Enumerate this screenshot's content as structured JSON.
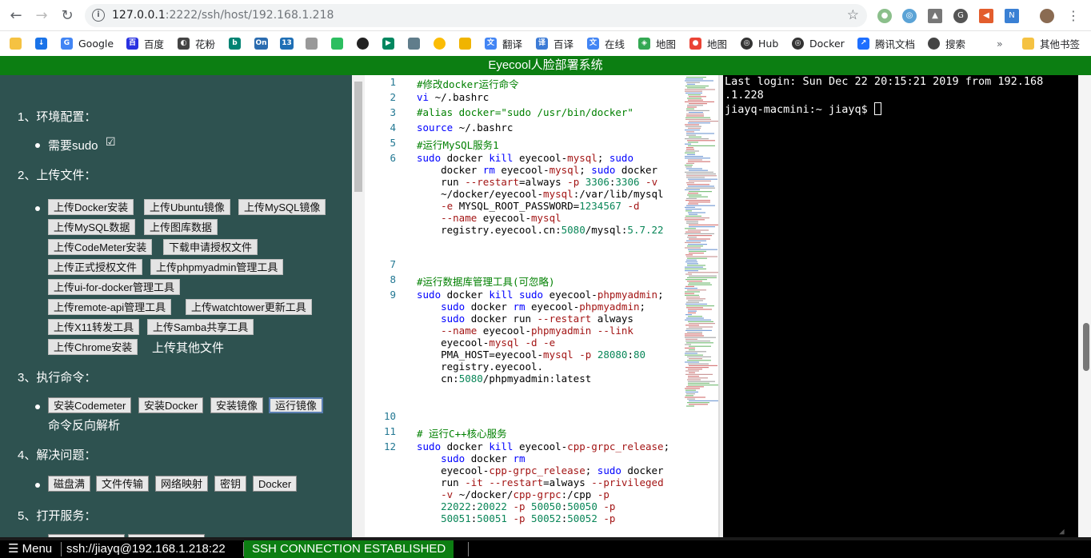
{
  "browser": {
    "url_host": "127.0.0.1",
    "url_rest": ":2222/ssh/host/192.168.1.218",
    "bookmarks": [
      "Google",
      "百度",
      "花粉",
      "",
      "On",
      "13",
      "",
      "",
      "",
      "",
      "",
      "",
      "",
      "",
      "翻译",
      "百译",
      "在线",
      "地图",
      "地图",
      "Hub",
      "Docker",
      "腾讯文档",
      "搜索",
      "其他书签"
    ]
  },
  "app": {
    "title": "Eyecool人脸部署系统"
  },
  "left": {
    "sections": {
      "s1": "1、环境配置：",
      "s2": "2、上传文件：",
      "s3": "3、执行命令：",
      "s4": "4、解决问题：",
      "s5": "5、打开服务："
    },
    "env": {
      "need_sudo": "需要sudo",
      "checkbox": "☑"
    },
    "upload": [
      "上传Docker安装",
      "上传Ubuntu镜像",
      "上传MySQL镜像",
      "上传MySQL数据",
      "上传图库数据",
      "上传CodeMeter安装",
      "下载申请授权文件",
      "上传正式授权文件",
      "上传phpmyadmin管理工具",
      "上传ui-for-docker管理工具",
      "上传remote-api管理工具",
      "上传watchtower更新工具",
      "上传X11转发工具",
      "上传Samba共享工具",
      "上传Chrome安装"
    ],
    "upload_other": "上传其他文件",
    "exec": [
      "安装Codemeter",
      "安装Docker",
      "安装镜像",
      "运行镜像"
    ],
    "exec_other": "命令反向解析",
    "fix": [
      "磁盘满",
      "文件传输",
      "网络映射",
      "密钥",
      "Docker"
    ]
  },
  "editor": {
    "line_numbers": [
      "1",
      "2",
      "3",
      "4",
      "5",
      "6",
      "7",
      "8",
      "9",
      "10",
      "11",
      "12"
    ]
  },
  "terminal": {
    "line1": "Last login: Sun Dec 22 20:15:21 2019 from 192.168",
    "line2": ".1.228",
    "prompt": "jiayq-macmini:~ jiayq$ "
  },
  "statusbar": {
    "menu": "☰ Menu",
    "host": "ssh://jiayq@192.168.1.218:22",
    "status": "SSH CONNECTION ESTABLISHED"
  },
  "colors": {
    "header_bg": "#0c7e12",
    "left_bg": "#2e5250",
    "status_ok": "#0c7e12"
  }
}
